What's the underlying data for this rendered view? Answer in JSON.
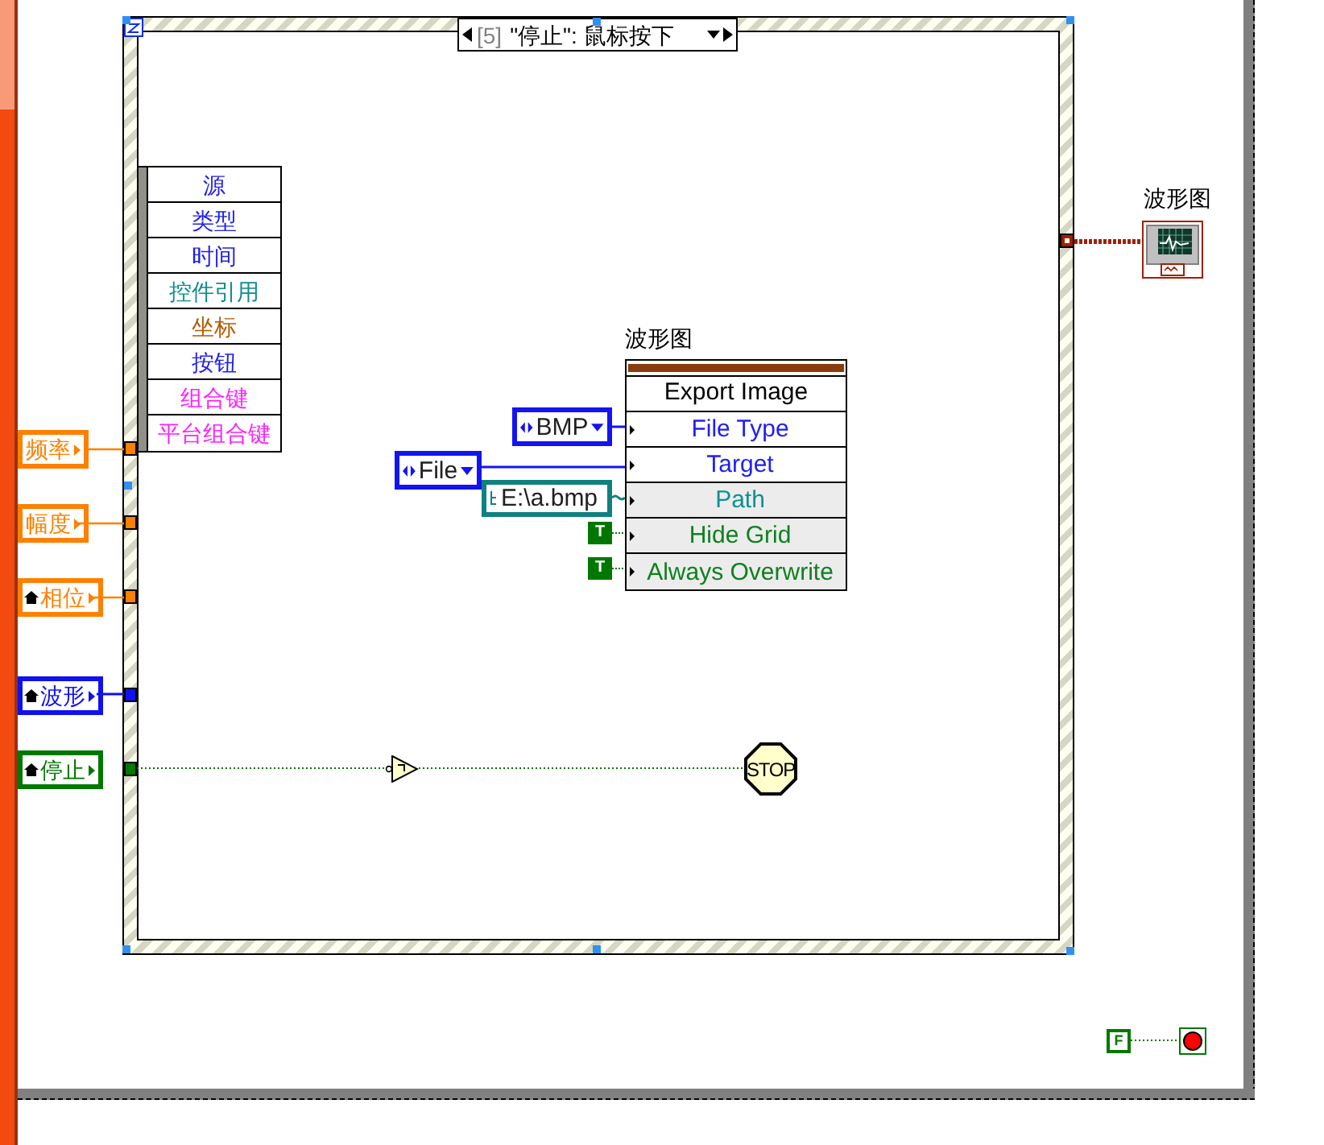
{
  "selector": {
    "index": "[5]",
    "event": "\"停止\": 鼠标按下"
  },
  "event_data": [
    {
      "label": "源",
      "color": "#2020e8"
    },
    {
      "label": "类型",
      "color": "#2020e8"
    },
    {
      "label": "时间",
      "color": "#2020e8"
    },
    {
      "label": "控件引用",
      "color": "#108c8c"
    },
    {
      "label": "坐标",
      "color": "#b45a00"
    },
    {
      "label": "按钮",
      "color": "#2020e8"
    },
    {
      "label": "组合键",
      "color": "#ff20ff"
    },
    {
      "label": "平台组合键",
      "color": "#ff20ff"
    }
  ],
  "terminals": [
    {
      "label": "频率",
      "color": "#ff8000",
      "home_icon": false
    },
    {
      "label": "幅度",
      "color": "#ff8000",
      "home_icon": false
    },
    {
      "label": "相位",
      "color": "#ff8000",
      "home_icon": true
    },
    {
      "label": "波形",
      "color": "#1010f0",
      "home_icon": true
    },
    {
      "label": "停止",
      "color": "#007800",
      "home_icon": true
    }
  ],
  "property_node": {
    "label": "波形图",
    "method": "Export Image",
    "rows": [
      {
        "label": "File Type",
        "color": "#2020f0",
        "shaded": false
      },
      {
        "label": "Target",
        "color": "#2020f0",
        "shaded": false
      },
      {
        "label": "Path",
        "color": "#109090",
        "shaded": true
      },
      {
        "label": "Hide Grid",
        "color": "#108020",
        "shaded": true
      },
      {
        "label": "Always Overwrite",
        "color": "#108020",
        "shaded": true
      }
    ]
  },
  "constants": {
    "file_type": "BMP",
    "target": "File",
    "path": "E:\\a.bmp",
    "hide_grid": "T",
    "always_overwrite": "T"
  },
  "stop_sign": "STOP",
  "graph_terminal": {
    "label": "波形图"
  },
  "loop_constant": "F"
}
